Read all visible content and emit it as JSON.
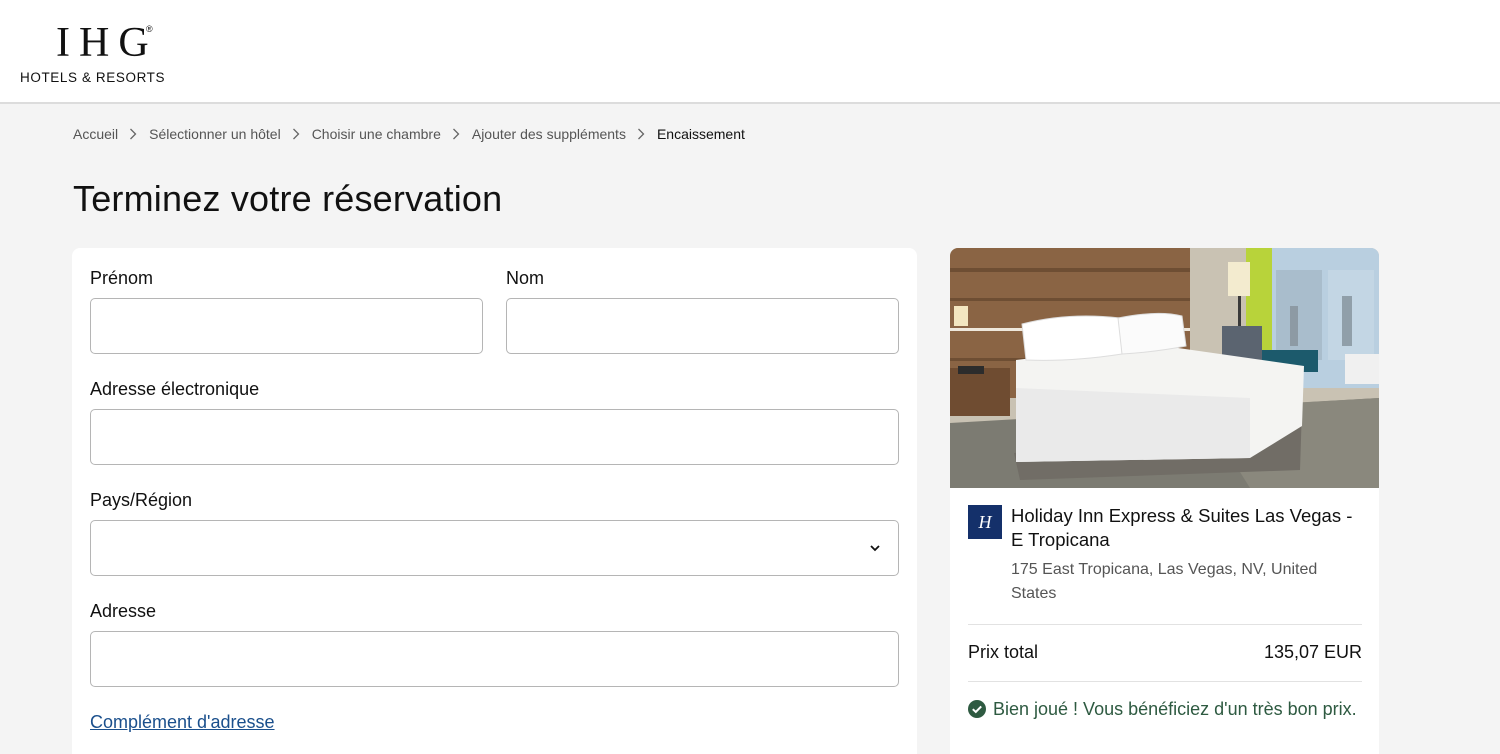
{
  "brand": {
    "logo_mark": "IHG",
    "logo_reg": "®",
    "logo_sub": "HOTELS & RESORTS"
  },
  "breadcrumb": {
    "items": [
      "Accueil",
      "Sélectionner un hôtel",
      "Choisir une chambre",
      "Ajouter des suppléments",
      "Encaissement"
    ]
  },
  "page": {
    "title": "Terminez votre réservation"
  },
  "form": {
    "first_name_label": "Prénom",
    "first_name_value": "",
    "last_name_label": "Nom",
    "last_name_value": "",
    "email_label": "Adresse électronique",
    "email_value": "",
    "country_label": "Pays/Région",
    "country_value": "",
    "address_label": "Adresse",
    "address_value": "",
    "address_more_link": "Complément d'adresse"
  },
  "hotel": {
    "brand_icon": "holiday-inn-express-icon",
    "brand_badge_text": "H",
    "name": "Holiday Inn Express & Suites Las Vegas - E Tropicana",
    "address": "175 East Tropicana, Las Vegas, NV, United States",
    "price_label": "Prix total",
    "price_value": "135,07 EUR",
    "deal_text": "Bien joué ! Vous bénéficiez d'un très bon prix."
  },
  "colors": {
    "background": "#f4f4f4",
    "brand_navy": "#14306a",
    "link_blue": "#1a4f8c",
    "deal_green": "#2e5a41"
  }
}
